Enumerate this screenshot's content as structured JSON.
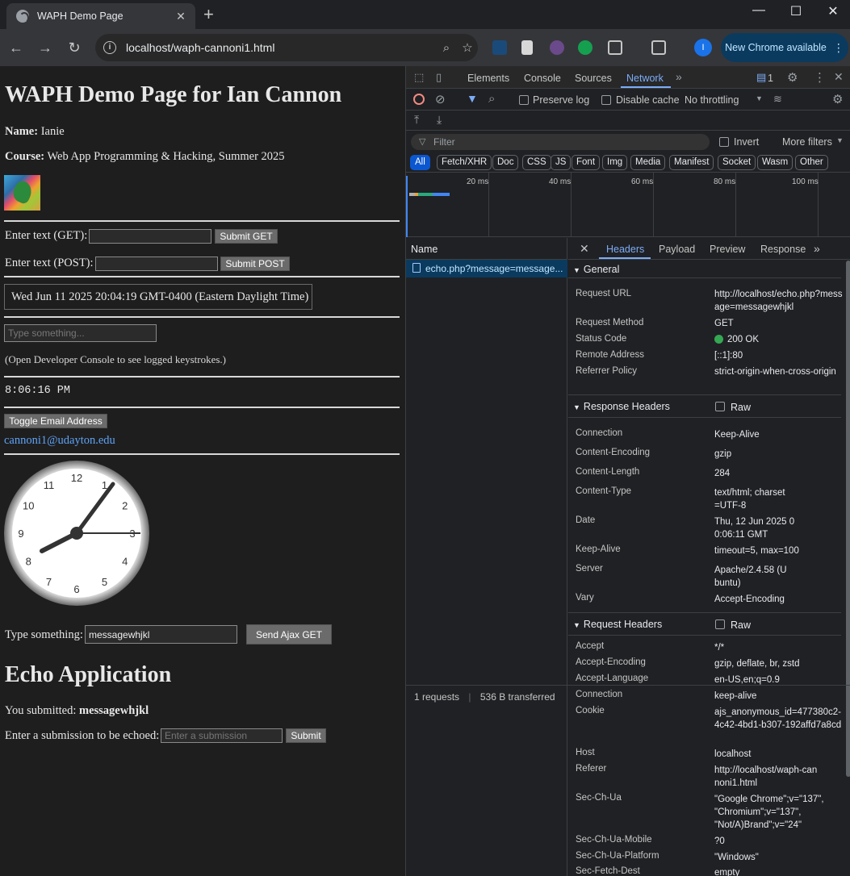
{
  "browser": {
    "tab_title": "WAPH Demo Page",
    "url": "localhost/waph-cannoni1.html",
    "profile_initial": "I",
    "update_button": "New Chrome available"
  },
  "page": {
    "title": "WAPH Demo Page for Ian Cannon",
    "name_label": "Name:",
    "name_value": "Ianie",
    "course_label": "Course:",
    "course_value": "Web App Programming & Hacking, Summer 2025",
    "get_label": "Enter text (GET):",
    "get_button": "Submit GET",
    "post_label": "Enter text (POST):",
    "post_button": "Submit POST",
    "date_text": "Wed Jun 11 2025 20:04:19 GMT-0400 (Eastern Daylight Time)",
    "keystroke_placeholder": "Type something...",
    "console_note": "(Open Developer Console to see logged keystrokes.)",
    "digital_time": "8:06:16 PM",
    "toggle_email_button": "Toggle Email Address",
    "email": "cannoni1@udayton.edu",
    "clock_numbers": [
      "12",
      "1",
      "2",
      "3",
      "4",
      "5",
      "6",
      "7",
      "8",
      "9",
      "10",
      "11"
    ],
    "ajax_label": "Type something:",
    "ajax_value": "messagewhjkl",
    "ajax_button": "Send Ajax GET",
    "echo_heading": "Echo Application",
    "submitted_label": "You submitted:",
    "submitted_value": "messagewhjkl",
    "echo_label": "Enter a submission to be echoed:",
    "echo_placeholder": "Enter a submission",
    "echo_button": "Submit"
  },
  "devtools": {
    "tabs": [
      "Elements",
      "Console",
      "Sources",
      "Network"
    ],
    "active_tab": "Network",
    "issues_count": "1",
    "preserve_log": "Preserve log",
    "disable_cache": "Disable cache",
    "throttling": "No throttling",
    "filter_placeholder": "Filter",
    "invert": "Invert",
    "more_filters": "More filters",
    "type_filters": [
      "All",
      "Fetch/XHR",
      "Doc",
      "CSS",
      "JS",
      "Font",
      "Img",
      "Media",
      "Manifest",
      "Socket",
      "Wasm",
      "Other"
    ],
    "timeline_labels": [
      "20 ms",
      "40 ms",
      "60 ms",
      "80 ms",
      "100 ms"
    ],
    "name_column": "Name",
    "request_name": "echo.php?message=message...",
    "status_requests": "1 requests",
    "status_transferred": "536 B transferred",
    "detail_tabs": [
      "Headers",
      "Payload",
      "Preview",
      "Response"
    ],
    "general": {
      "title": "General",
      "rows": [
        {
          "k": "Request URL",
          "v": "http://localhost/echo.php?message=messagewhjkl"
        },
        {
          "k": "Request Method",
          "v": "GET"
        },
        {
          "k": "Status Code",
          "v": "200 OK"
        },
        {
          "k": "Remote Address",
          "v": "[::1]:80"
        },
        {
          "k": "Referrer Policy",
          "v": "strict-origin-when-cross-origin"
        }
      ]
    },
    "response_headers": {
      "title": "Response Headers",
      "raw": "Raw",
      "rows": [
        {
          "k": "Connection",
          "v": "Keep-Alive"
        },
        {
          "k": "Content-Encoding",
          "v": "gzip"
        },
        {
          "k": "Content-Length",
          "v": "284"
        },
        {
          "k": "Content-Type",
          "v": "text/html; charset=UTF-8"
        },
        {
          "k": "Date",
          "v": "Thu, 12 Jun 2025 00:06:11 GMT"
        },
        {
          "k": "Keep-Alive",
          "v": "timeout=5, max=100"
        },
        {
          "k": "Server",
          "v": "Apache/2.4.58 (Ubuntu)"
        },
        {
          "k": "Vary",
          "v": "Accept-Encoding"
        }
      ]
    },
    "request_headers": {
      "title": "Request Headers",
      "raw": "Raw",
      "rows": [
        {
          "k": "Accept",
          "v": "*/*"
        },
        {
          "k": "Accept-Encoding",
          "v": "gzip, deflate, br, zstd"
        },
        {
          "k": "Accept-Language",
          "v": "en-US,en;q=0.9"
        },
        {
          "k": "Connection",
          "v": "keep-alive"
        },
        {
          "k": "Cookie",
          "v": "ajs_anonymous_id=477380c2-4c42-4bd1-b307-192affd7a8cd"
        },
        {
          "k": "Host",
          "v": "localhost"
        },
        {
          "k": "Referer",
          "v": "http://localhost/waph-cannoni1.html"
        },
        {
          "k": "Sec-Ch-Ua",
          "v": "\"Google Chrome\";v=\"137\", \"Chromium\";v=\"137\", \"Not/A)Brand\";v=\"24\""
        },
        {
          "k": "Sec-Ch-Ua-Mobile",
          "v": "?0"
        },
        {
          "k": "Sec-Ch-Ua-Platform",
          "v": "\"Windows\""
        },
        {
          "k": "Sec-Fetch-Dest",
          "v": "empty"
        }
      ]
    }
  }
}
